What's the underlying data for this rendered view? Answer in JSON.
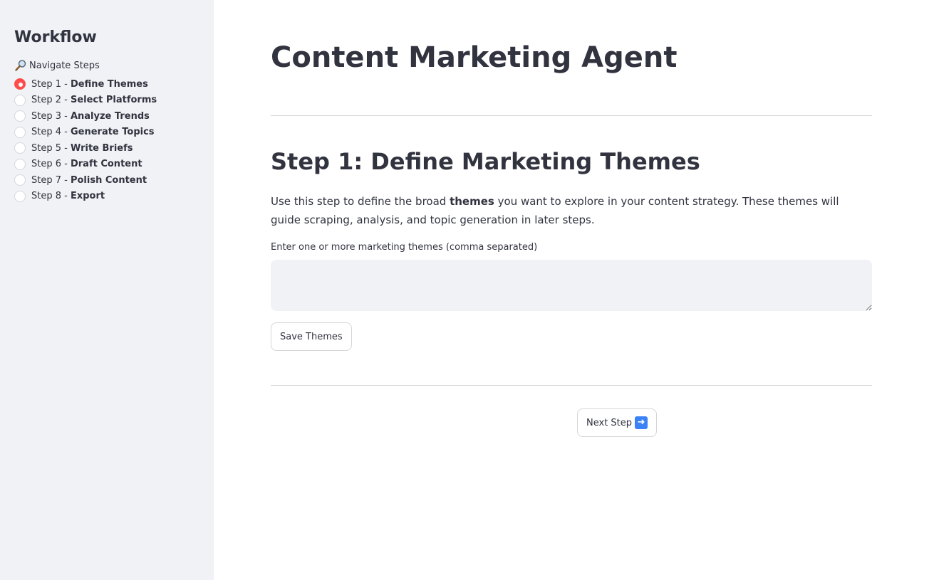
{
  "sidebar": {
    "title": "Workflow",
    "nav_icon": "magnifier-icon",
    "nav_label": "Navigate Steps",
    "selected_index": 0,
    "steps": [
      {
        "prefix": "Step 1 - ",
        "name": "Define Themes"
      },
      {
        "prefix": "Step 2 - ",
        "name": "Select Platforms"
      },
      {
        "prefix": "Step 3 - ",
        "name": "Analyze Trends"
      },
      {
        "prefix": "Step 4 - ",
        "name": "Generate Topics"
      },
      {
        "prefix": "Step 5 - ",
        "name": "Write Briefs"
      },
      {
        "prefix": "Step 6 - ",
        "name": "Draft Content"
      },
      {
        "prefix": "Step 7 - ",
        "name": "Polish Content"
      },
      {
        "prefix": "Step 8 - ",
        "name": "Export"
      }
    ]
  },
  "main": {
    "page_title": "Content Marketing Agent",
    "step_title": "Step 1: Define Marketing Themes",
    "description": {
      "before": "Use this step to define the broad ",
      "bold": "themes",
      "after": " you want to explore in your content strategy. These themes will guide scraping, analysis, and topic generation in later steps."
    },
    "field_label": "Enter one or more marketing themes (comma separated)",
    "field_value": "",
    "save_label": "Save Themes",
    "next_label": "Next Step",
    "next_icon": "right-arrow-icon"
  },
  "colors": {
    "accent": "#ff4b4b",
    "sidebar_bg": "#f0f2f6",
    "text": "#31333f"
  }
}
